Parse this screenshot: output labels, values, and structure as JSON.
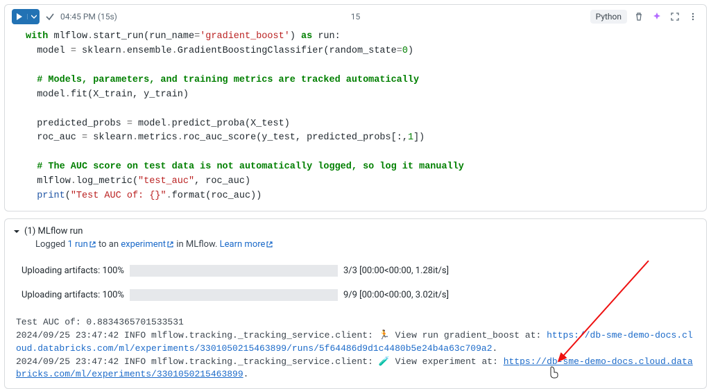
{
  "toolbar": {
    "time": "04:45 PM",
    "duration": "(15s)",
    "cell_number": "15",
    "language": "Python"
  },
  "code": {
    "l1a": "with",
    "l1b": " mlflow",
    "l1c": ".",
    "l1d": "start_run",
    "l1e": "(run_name",
    "l1f": "=",
    "l1g": "'gradient_boost'",
    "l1h": ") ",
    "l1i": "as",
    "l1j": " run:",
    "l2a": "  model ",
    "l2b": "=",
    "l2c": " sklearn",
    "l2d": ".",
    "l2e": "ensemble",
    "l2f": ".",
    "l2g": "GradientBoostingClassifier",
    "l2h": "(random_state",
    "l2i": "=",
    "l2j": "0",
    "l2k": ")",
    "l3": "  # Models, parameters, and training metrics are tracked automatically",
    "l4a": "  model",
    "l4b": ".",
    "l4c": "fit",
    "l4d": "(X_train, y_train)",
    "l5a": "  predicted_probs ",
    "l5b": "=",
    "l5c": " model",
    "l5d": ".",
    "l5e": "predict_proba",
    "l5f": "(X_test)",
    "l6a": "  roc_auc ",
    "l6b": "=",
    "l6c": " sklearn",
    "l6d": ".",
    "l6e": "metrics",
    "l6f": ".",
    "l6g": "roc_auc_score",
    "l6h": "(y_test, predicted_probs[:,",
    "l6i": "1",
    "l6j": "])",
    "l7": "  # The AUC score on test data is not automatically logged, so log it manually",
    "l8a": "  mlflow",
    "l8b": ".",
    "l8c": "log_metric",
    "l8d": "(",
    "l8e": "\"test_auc\"",
    "l8f": ", roc_auc)",
    "l9a": "  ",
    "l9b": "print",
    "l9c": "(",
    "l9d": "\"Test AUC of: {}\"",
    "l9e": ".",
    "l9f": "format",
    "l9g": "(roc_auc))"
  },
  "output": {
    "header_count": "(1)",
    "header_label": "MLflow run",
    "sub_logged": "Logged ",
    "sub_run": "1 run",
    "sub_toan": " to an ",
    "sub_exp": "experiment",
    "sub_inml": " in MLflow. ",
    "sub_learn": "Learn more",
    "prog1_label": "Uploading artifacts: 100%",
    "prog1_stats": "3/3 [00:00<00:00, 1.28it/s]",
    "prog2_label": "Uploading artifacts: 100%",
    "prog2_stats": "9/9 [00:00<00:00, 3.02it/s]",
    "c_testauc": "Test AUC of: 0.8834365701533531",
    "c_ts1": "2024/09/25 23:47:42 INFO mlflow.tracking._tracking_service.client: 🏃 View run gradient_boost at: ",
    "c_url1": "https://db-sme-demo-docs.cloud.databricks.com/ml/experiments/3301050215463899/runs/5f64486d9d1c4480b5e24b4a63c709a2",
    "c_dot1": ".",
    "c_ts2": "2024/09/25 23:47:42 INFO mlflow.tracking._tracking_service.client: 🧪 View experiment at: ",
    "c_url2": "https://db-sme-demo-docs.cloud.databricks.com/ml/experiments/3301050215463899",
    "c_dot2": "."
  }
}
